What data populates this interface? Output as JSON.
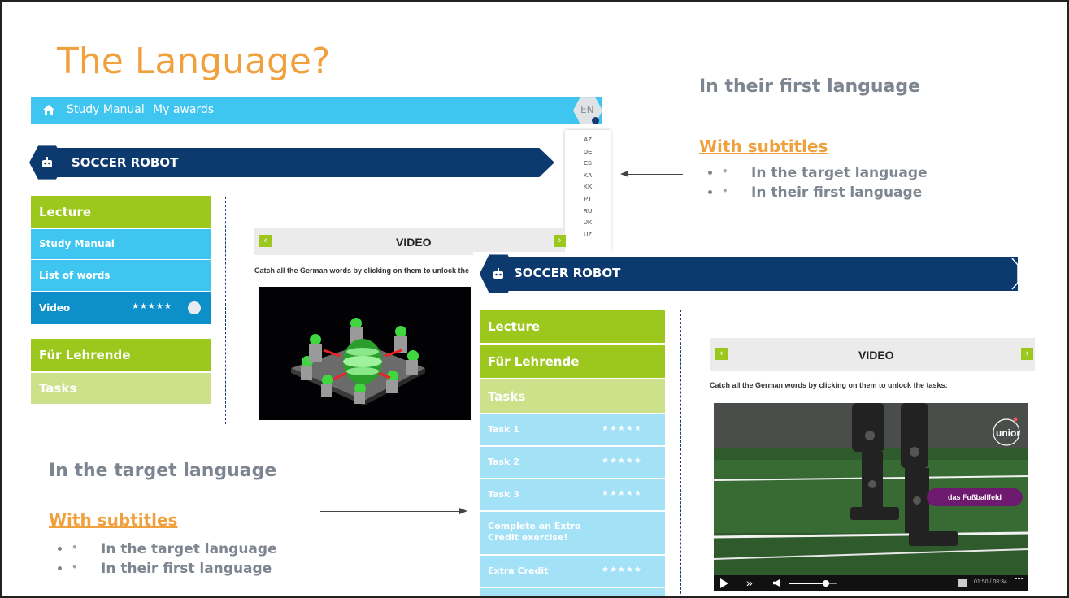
{
  "slide": {
    "title": "The Language?",
    "right_heading": "In their first language",
    "right_subtitles": "With subtitles",
    "right_bullets": [
      "In the target language",
      "In their first language"
    ],
    "left_heading": "In the target language",
    "left_subtitles": "With subtitles",
    "left_bullets": [
      "In the target language",
      "In their first language"
    ]
  },
  "nav": {
    "study_manual": "Study Manual",
    "my_awards": "My awards",
    "lang": "EN",
    "lang_options": [
      "AZ",
      "DE",
      "ES",
      "KA",
      "KK",
      "PT",
      "RU",
      "UK",
      "UZ"
    ]
  },
  "left_shot": {
    "banner": "SOCCER ROBOT",
    "menu": {
      "lecture": "Lecture",
      "study_manual": "Study Manual",
      "list_of_words": "List of words",
      "video": "Video",
      "fur_lehrende": "Für Lehrende",
      "tasks": "Tasks"
    },
    "video_label": "VIDEO",
    "caption": "Catch all the German words by clicking on them to unlock the"
  },
  "right_shot": {
    "banner": "SOCCER ROBOT",
    "menu": {
      "lecture": "Lecture",
      "fur_lehrende": "Für Lehrende",
      "tasks": "Tasks",
      "task1": "Task 1",
      "task2": "Task 2",
      "task3": "Task 3",
      "extra_exercise": "Complete an Extra Credit exercise!",
      "extra_credit": "Extra Credit"
    },
    "video_label": "VIDEO",
    "caption": "Catch all the German words by clicking on them to unlock the tasks:",
    "subtitle_word": "das Fußballfeld",
    "logo_text": "unior",
    "time": "01:50 / 08:34"
  },
  "colors": {
    "orange": "#f0a03c",
    "nav_blue": "#3ec6f1",
    "navy": "#0d3a6e",
    "green": "#9cc71c",
    "light_green": "#cde08a"
  },
  "stars_text": "★★★★★"
}
